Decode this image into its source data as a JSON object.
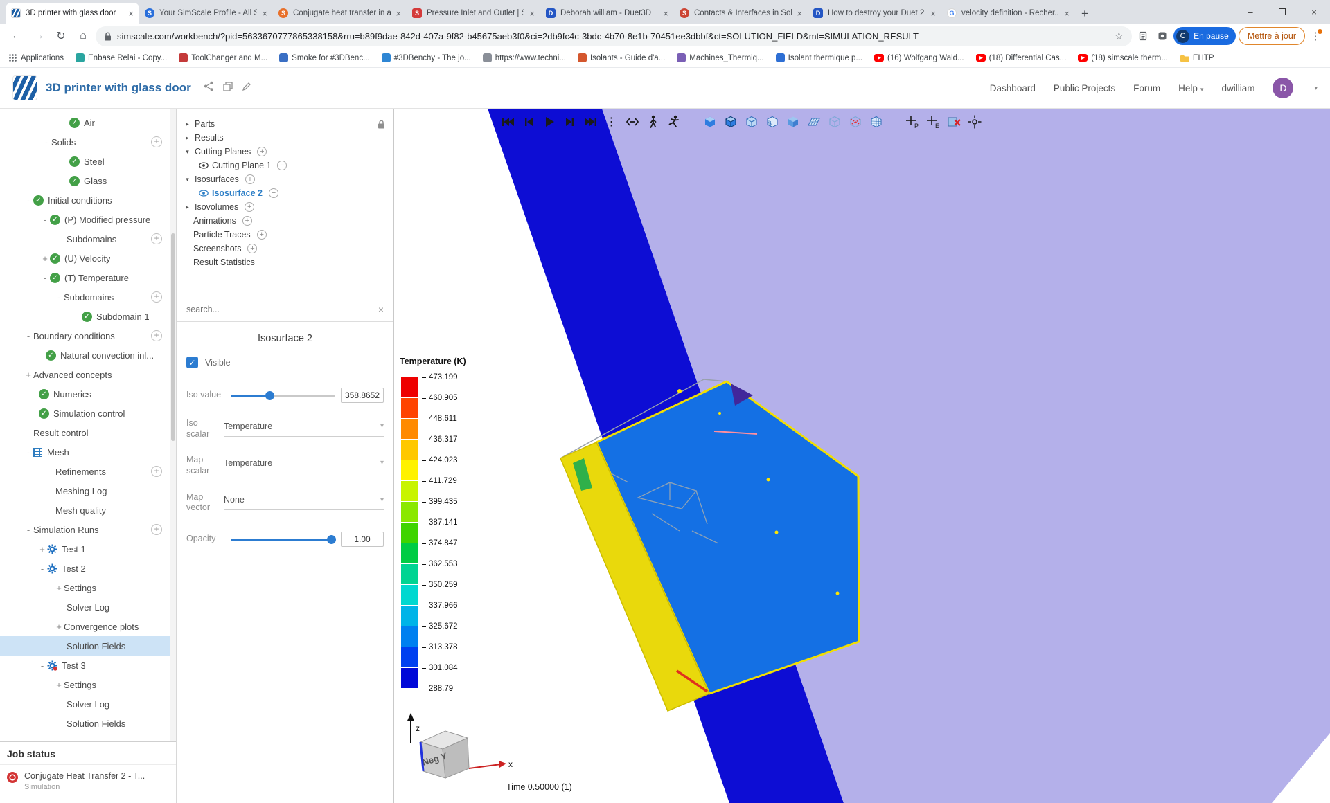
{
  "browser": {
    "tabs": [
      {
        "title": "3D printer with glass door"
      },
      {
        "title": "Your SimScale Profile - All S..."
      },
      {
        "title": "Conjugate heat transfer in a..."
      },
      {
        "title": "Pressure Inlet and Outlet | S..."
      },
      {
        "title": "Deborah william - Duet3D"
      },
      {
        "title": "Contacts & Interfaces in Sol..."
      },
      {
        "title": "How to destroy your Duet 2..."
      },
      {
        "title": "velocity definition - Recher..."
      }
    ],
    "url": "simscale.com/workbench/?pid=5633670777865338158&rru=b89f9dae-842d-407a-9f82-b45675aeb3f0&ci=2db9fc4c-3bdc-4b70-8e1b-70451ee3dbbf&ct=SOLUTION_FIELD&mt=SIMULATION_RESULT",
    "pause_chip": "En pause",
    "pause_avatar": "C",
    "update_button": "Mettre à jour",
    "bookmarks": [
      "Applications",
      "Enbase Relai - Copy...",
      "ToolChanger and M...",
      "Smoke for #3DBenc...",
      "#3DBenchy - The jo...",
      "https://www.techni...",
      "Isolants - Guide d'a...",
      "Machines_Thermiq...",
      "Isolant thermique p...",
      "(16) Wolfgang Wald...",
      "(18) Differential Cas...",
      "(18) simscale therm...",
      "EHTP"
    ]
  },
  "app_header": {
    "title": "3D printer with glass door",
    "nav": [
      "Dashboard",
      "Public Projects",
      "Forum",
      "Help"
    ],
    "user": "dwilliam",
    "avatar_letter": "D"
  },
  "sim_tree": {
    "items": [
      "Air",
      "Solids",
      "Steel",
      "Glass",
      "Initial conditions",
      "(P) Modified pressure",
      "Subdomains",
      "(U) Velocity",
      "(T) Temperature",
      "Subdomains",
      "Subdomain 1",
      "Boundary conditions",
      "Natural convection inl...",
      "Advanced concepts",
      "Numerics",
      "Simulation control",
      "Result control",
      "Mesh",
      "Refinements",
      "Meshing Log",
      "Mesh quality",
      "Simulation Runs",
      "Test 1",
      "Test 2",
      "Settings",
      "Solver Log",
      "Convergence plots",
      "Solution Fields",
      "Test 3",
      "Settings",
      "Solver Log",
      "Solution Fields"
    ]
  },
  "job_status": {
    "title": "Job status",
    "job_name": "Conjugate Heat Transfer 2 - T...",
    "job_type": "Simulation"
  },
  "post_tree": {
    "items": [
      "Parts",
      "Results",
      "Cutting Planes",
      "Cutting Plane 1",
      "Isosurfaces",
      "Isosurface 2",
      "Isovolumes",
      "Animations",
      "Particle Traces",
      "Screenshots",
      "Result Statistics"
    ],
    "search_placeholder": "search..."
  },
  "properties": {
    "title": "Isosurface 2",
    "visible_label": "Visible",
    "iso_value_label": "Iso value",
    "iso_value": "358.8652",
    "iso_scalar_label": "Iso scalar",
    "iso_scalar_value": "Temperature",
    "map_scalar_label": "Map scalar",
    "map_scalar_value": "Temperature",
    "map_vector_label": "Map vector",
    "map_vector_value": "None",
    "opacity_label": "Opacity",
    "opacity_value": "1.00"
  },
  "viewport": {
    "legend_title": "Temperature (K)",
    "legend_values": [
      "473.199",
      "460.905",
      "448.611",
      "436.317",
      "424.023",
      "411.729",
      "399.435",
      "387.141",
      "374.847",
      "362.553",
      "350.259",
      "337.966",
      "325.672",
      "313.378",
      "301.084",
      "288.79"
    ],
    "legend_colors": [
      "#ee0000",
      "#ff4400",
      "#ff8a00",
      "#ffc800",
      "#fff200",
      "#c8f400",
      "#8ae800",
      "#3fd400",
      "#00cc44",
      "#00d492",
      "#00d8d0",
      "#00b4e8",
      "#0080f0",
      "#0040f0",
      "#0008d8"
    ],
    "time_label": "Time 0.50000 (1)",
    "cube_label": "Neg Y",
    "axis_x": "x",
    "axis_z": "z",
    "colors": {
      "plane_glass": "#b4b0ea",
      "plane_cut": "#0d0dd4",
      "box_face": "#1470e4",
      "box_panel": "#e9d90c"
    }
  }
}
